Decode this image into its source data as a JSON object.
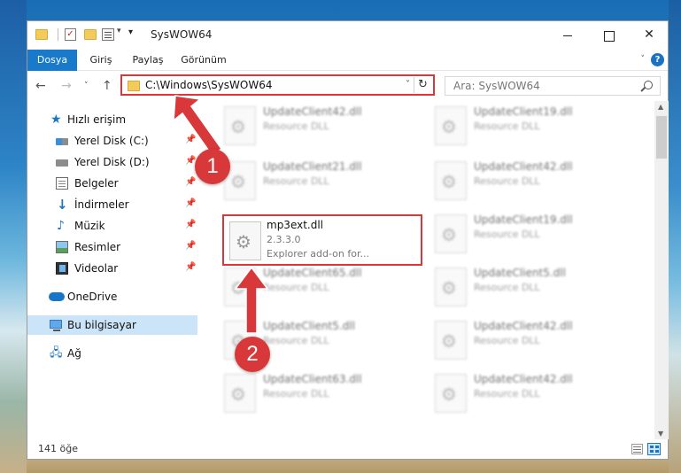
{
  "window": {
    "title": "SysWOW64"
  },
  "ribbon": {
    "tabs": [
      "Dosya",
      "Giriş",
      "Paylaş",
      "Görünüm"
    ],
    "help": "?"
  },
  "address": {
    "path": "C:\\Windows\\SysWOW64"
  },
  "search": {
    "placeholder": "Ara: SysWOW64"
  },
  "sidebar": {
    "items": [
      {
        "label": "Hızlı erişim",
        "icon": "star-icon"
      },
      {
        "label": "Yerel Disk (C:)",
        "icon": "disk-icon",
        "pinned": true
      },
      {
        "label": "Yerel Disk (D:)",
        "icon": "disk-icon",
        "pinned": true
      },
      {
        "label": "Belgeler",
        "icon": "documents-icon",
        "pinned": true
      },
      {
        "label": "İndirmeler",
        "icon": "downloads-icon",
        "pinned": true
      },
      {
        "label": "Müzik",
        "icon": "music-icon",
        "pinned": true
      },
      {
        "label": "Resimler",
        "icon": "pictures-icon",
        "pinned": true
      },
      {
        "label": "Videolar",
        "icon": "videos-icon",
        "pinned": true
      },
      {
        "label": "OneDrive",
        "icon": "onedrive-icon"
      },
      {
        "label": "Bu bilgisayar",
        "icon": "computer-icon",
        "selected": true
      },
      {
        "label": "Ağ",
        "icon": "network-icon"
      }
    ]
  },
  "files": {
    "left": [
      {
        "name": "UpdateClient42.dll",
        "desc": "Resource DLL"
      },
      {
        "name": "UpdateClient21.dll",
        "desc": "Resource DLL"
      },
      {
        "name": "mp3ext.dll",
        "version": "2.3.3.0",
        "desc": "Explorer add-on for..."
      },
      {
        "name": "UpdateClient65.dll",
        "desc": "Resource DLL"
      },
      {
        "name": "UpdateClient5.dll",
        "desc": "Resource DLL"
      },
      {
        "name": "UpdateClient63.dll",
        "desc": "Resource DLL"
      }
    ],
    "right": [
      {
        "name": "UpdateClient19.dll",
        "desc": "Resource DLL"
      },
      {
        "name": "UpdateClient42.dll",
        "desc": "Resource DLL"
      },
      {
        "name": "UpdateClient19.dll",
        "desc": "Resource DLL"
      },
      {
        "name": "UpdateClient5.dll",
        "desc": "Resource DLL"
      },
      {
        "name": "UpdateClient42.dll",
        "desc": "Resource DLL"
      },
      {
        "name": "UpdateClient42.dll",
        "desc": "Resource DLL"
      }
    ]
  },
  "status": {
    "count": "141 öğe"
  },
  "annotations": {
    "step1": "1",
    "step2": "2",
    "color": "#d9383a"
  }
}
